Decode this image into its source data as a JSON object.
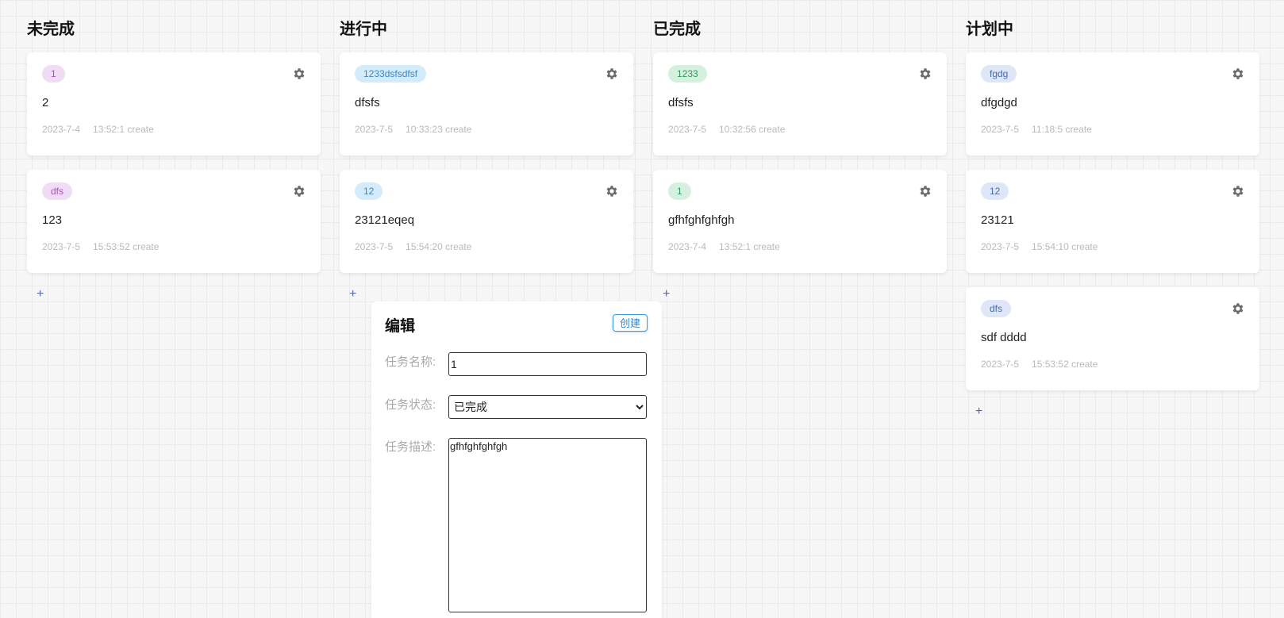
{
  "columns": [
    {
      "title": "未完成",
      "add_label": "+",
      "cards": [
        {
          "tag": "1",
          "title": "2",
          "date": "2023-7-4",
          "time": "13:52:1 create"
        },
        {
          "tag": "dfs",
          "title": "123",
          "date": "2023-7-5",
          "time": "15:53:52 create"
        }
      ]
    },
    {
      "title": "进行中",
      "add_label": "+",
      "cards": [
        {
          "tag": "1233dsfsdfsf",
          "title": "dfsfs",
          "date": "2023-7-5",
          "time": "10:33:23 create"
        },
        {
          "tag": "12",
          "title": "23121eqeq",
          "date": "2023-7-5",
          "time": "15:54:20 create"
        }
      ]
    },
    {
      "title": "已完成",
      "add_label": "+",
      "cards": [
        {
          "tag": "1233",
          "title": "dfsfs",
          "date": "2023-7-5",
          "time": "10:32:56 create"
        },
        {
          "tag": "1",
          "title": "gfhfghfghfgh",
          "date": "2023-7-4",
          "time": "13:52:1 create"
        }
      ]
    },
    {
      "title": "计划中",
      "add_label": "+",
      "cards": [
        {
          "tag": "fgdg",
          "title": "dfgdgd",
          "date": "2023-7-5",
          "time": "11:18:5 create"
        },
        {
          "tag": "12",
          "title": "23121",
          "date": "2023-7-5",
          "time": "15:54:10 create"
        },
        {
          "tag": "dfs",
          "title": "sdf dddd",
          "date": "2023-7-5",
          "time": "15:53:52 create"
        }
      ]
    }
  ],
  "dialog": {
    "title": "编辑",
    "create_label": "创建",
    "name_label": "任务名称:",
    "name_value": "1",
    "status_label": "任务状态:",
    "status_value": "已完成",
    "desc_label": "任务描述:",
    "desc_value": "gfhfghfghfgh"
  },
  "colors": {
    "tag_pink": "#f1dcf6",
    "tag_blue": "#d4ebfb",
    "tag_green": "#d6f0e0",
    "tag_lavender": "#dfe6f7",
    "accent": "#4a67d8"
  },
  "icons": {
    "card_menu": "gear-icon",
    "add": "plus-icon"
  }
}
